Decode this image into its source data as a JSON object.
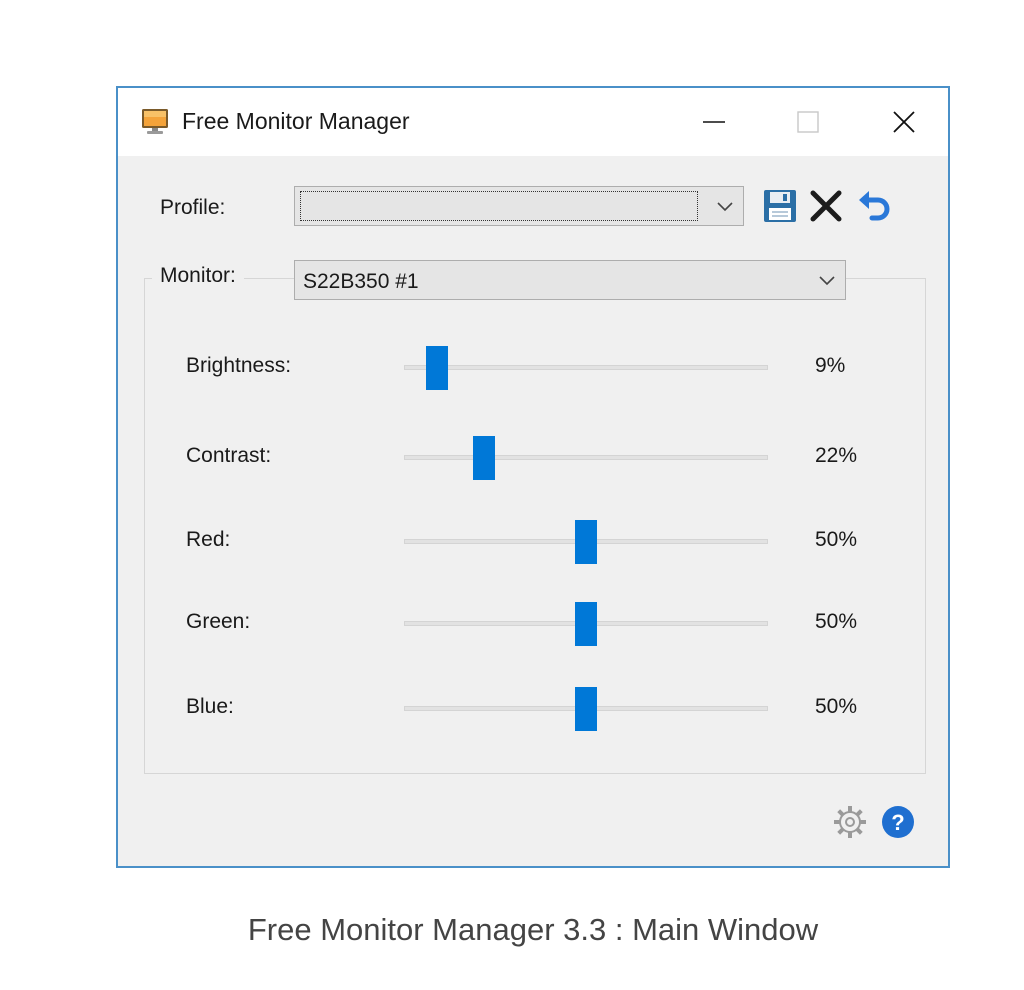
{
  "window": {
    "title": "Free Monitor Manager",
    "icon": "monitor-icon"
  },
  "titlebar_buttons": {
    "minimize": "minimize-icon",
    "maximize": "maximize-icon",
    "close": "close-icon"
  },
  "profile": {
    "label": "Profile:",
    "value": ""
  },
  "toolbar": {
    "save": "save-icon",
    "delete": "delete-icon",
    "undo": "undo-icon"
  },
  "monitor": {
    "label": "Monitor:",
    "value": "S22B350 #1"
  },
  "sliders": [
    {
      "label": "Brightness:",
      "value": 9,
      "value_text": "9%"
    },
    {
      "label": "Contrast:",
      "value": 22,
      "value_text": "22%"
    },
    {
      "label": "Red:",
      "value": 50,
      "value_text": "50%"
    },
    {
      "label": "Green:",
      "value": 50,
      "value_text": "50%"
    },
    {
      "label": "Blue:",
      "value": 50,
      "value_text": "50%"
    }
  ],
  "footer": {
    "settings": "gear-icon",
    "help": "help-icon"
  },
  "colors": {
    "accent": "#0078d7",
    "window_border": "#4a90c8",
    "help_blue": "#1f6fd0",
    "undo_blue": "#2a78d8"
  },
  "caption": "Free Monitor Manager 3.3 : Main Window"
}
